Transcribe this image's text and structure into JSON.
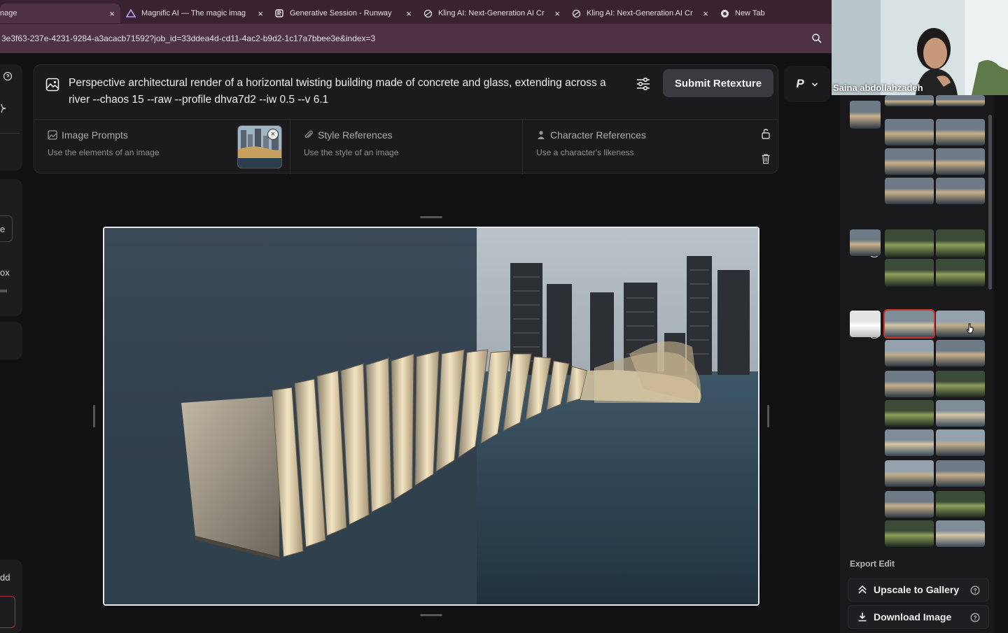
{
  "browser": {
    "tabs": [
      {
        "title": "nage",
        "icon": "image-icon",
        "active": true
      },
      {
        "title": "Magnific AI — The magic imag",
        "icon": "magnific-logo-icon",
        "active": false
      },
      {
        "title": "Generative Session - Runway",
        "icon": "runway-logo-icon",
        "active": false
      },
      {
        "title": "Kling AI: Next-Generation AI Cr",
        "icon": "kling-logo-icon",
        "active": false
      },
      {
        "title": "Kling AI: Next-Generation AI Cr",
        "icon": "kling-logo-icon",
        "active": false
      },
      {
        "title": "New Tab",
        "icon": "chrome-icon",
        "active": false
      }
    ],
    "close_glyph": "×",
    "url": "3e3f63-237e-4231-9284-a3acacb71592?job_id=33ddea4d-cd11-4ac2-b9d2-1c17a7bbee3e&index=3"
  },
  "left_rail": {
    "text_1": "e",
    "text_2": "ox",
    "text_3": "dd"
  },
  "prompt": {
    "text": "Perspective architectural render of a horizontal twisting building made of concrete and glass, extending across a river --chaos 15 --raw --profile dhva7d2 --iw 0.5 --v 6.1",
    "submit_label": "Submit Retexture",
    "preset_label": "P"
  },
  "references": [
    {
      "title": "Image Prompts",
      "subtitle": "Use the elements of an image",
      "icon": "image-prompt-icon"
    },
    {
      "title": "Style References",
      "subtitle": "Use the style of an image",
      "icon": "paperclip-icon"
    },
    {
      "title": "Character References",
      "subtitle": "Use a character's likeness",
      "icon": "person-icon"
    }
  ],
  "gallery": {
    "badge": "R",
    "export_label": "Export Edit",
    "upscale_label": "Upscale to Gallery",
    "download_label": "Download Image"
  },
  "video": {
    "participant_name": "Saina abdollahzadeh"
  },
  "colors": {
    "tabbar": "#3a2230",
    "urlbar": "#4e3243",
    "panel": "#1b1b1e",
    "selected_thumb": "#d4322c"
  }
}
